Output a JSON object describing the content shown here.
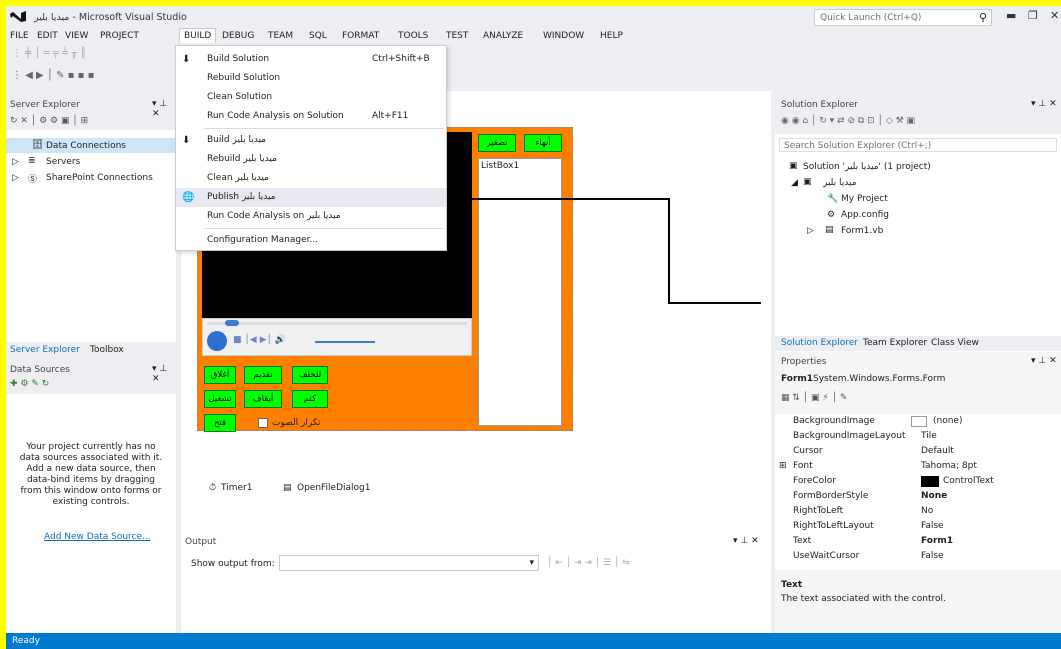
{
  "window": {
    "title": "ميديا بلير - Microsoft Visual Studio",
    "quick_launch": "Quick Launch (Ctrl+Q)"
  },
  "menu": [
    "FILE",
    "EDIT",
    "VIEW",
    "PROJECT",
    "BUILD",
    "DEBUG",
    "TEAM",
    "SQL",
    "FORMAT",
    "TOOLS",
    "TEST",
    "ANALYZE",
    "WINDOW",
    "HELP"
  ],
  "build_menu": {
    "items": [
      {
        "label": "Build Solution",
        "key": "Ctrl+Shift+B"
      },
      {
        "label": "Rebuild Solution",
        "key": ""
      },
      {
        "label": "Clean Solution",
        "key": ""
      },
      {
        "label": "Run Code Analysis on Solution",
        "key": "Alt+F11"
      },
      {
        "label": "Build ميديا بلير",
        "key": ""
      },
      {
        "label": "Rebuild ميديا بلير",
        "key": ""
      },
      {
        "label": "Clean ميديا بلير",
        "key": ""
      },
      {
        "label": "Publish ميديا بلير",
        "key": ""
      },
      {
        "label": "Run Code Analysis on ميديا بلير",
        "key": ""
      },
      {
        "label": "Configuration Manager...",
        "key": ""
      }
    ]
  },
  "server_explorer": {
    "title": "Server Explorer",
    "items": [
      "Data Connections",
      "Servers",
      "SharePoint Connections"
    ],
    "tabs": [
      "Server Explorer",
      "Toolbox"
    ]
  },
  "data_sources": {
    "title": "Data Sources",
    "message": "Your project currently has no data sources associated with it. Add a new data source, then data-bind items by dragging from this window onto forms or existing controls.",
    "link": "Add New Data Source..."
  },
  "form": {
    "buttons": {
      "minimize": "تصغير",
      "close": "أنهاء",
      "back": "للخلف",
      "forward": "تقديم",
      "open_file": "أغلاق",
      "stop": "أيقاف",
      "mute": "كتم",
      "play": "تشغيل",
      "open": "فتح"
    },
    "listbox": "ListBox1",
    "checkbox": "تكرار الصوت"
  },
  "tray": {
    "timer": "Timer1",
    "dialog": "OpenFileDialog1"
  },
  "output": {
    "title": "Output",
    "show_from": "Show output from:"
  },
  "solution_explorer": {
    "title": "Solution Explorer",
    "search": "Search Solution Explorer (Ctrl+;)",
    "solution": "Solution 'ميديا بلير' (1 project)",
    "project": "ميديا بلير",
    "items": [
      "My Project",
      "App.config",
      "Form1.vb"
    ],
    "tabs": [
      "Solution Explorer",
      "Team Explorer",
      "Class View"
    ]
  },
  "properties": {
    "title": "Properties",
    "object": "Form1",
    "type": "System.Windows.Forms.Form",
    "rows": [
      {
        "name": "BackgroundImage",
        "value": "(none)"
      },
      {
        "name": "BackgroundImageLayout",
        "value": "Tile"
      },
      {
        "name": "Cursor",
        "value": "Default"
      },
      {
        "name": "Font",
        "value": "Tahoma; 8pt"
      },
      {
        "name": "ForeColor",
        "value": "ControlText"
      },
      {
        "name": "FormBorderStyle",
        "value": "None"
      },
      {
        "name": "RightToLeft",
        "value": "No"
      },
      {
        "name": "RightToLeftLayout",
        "value": "False"
      },
      {
        "name": "Text",
        "value": "Form1"
      },
      {
        "name": "UseWaitCursor",
        "value": "False"
      }
    ],
    "desc_title": "Text",
    "desc": "The text associated with the control."
  },
  "status": "Ready"
}
